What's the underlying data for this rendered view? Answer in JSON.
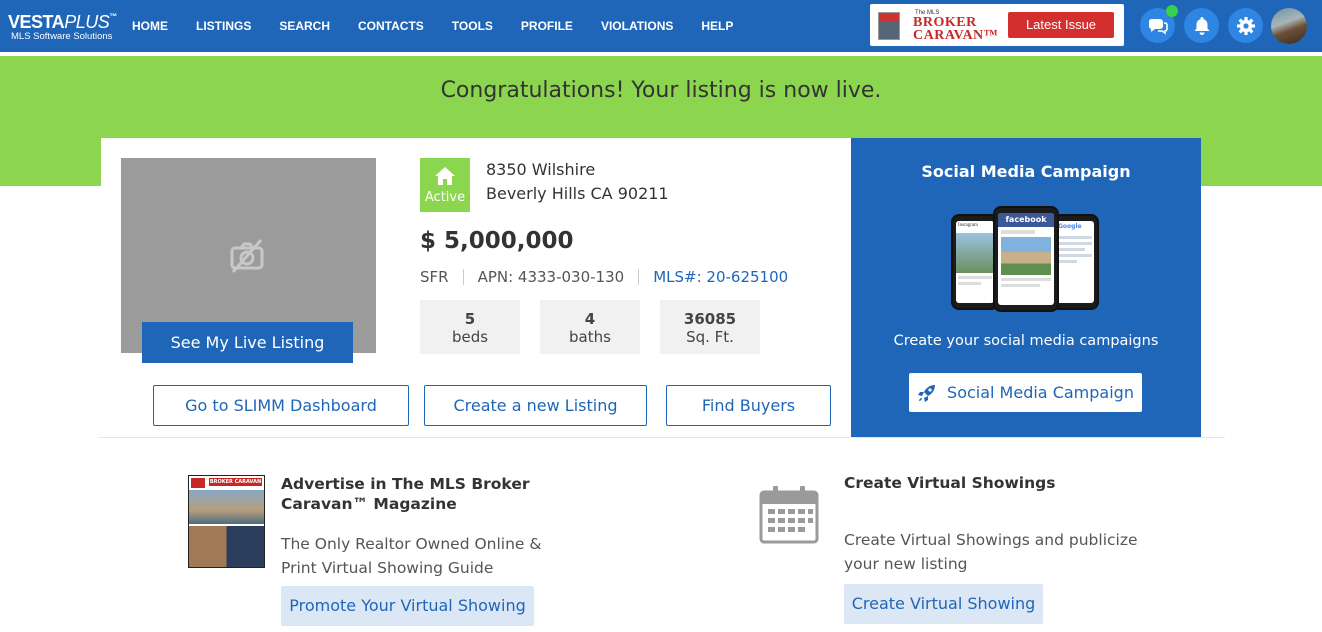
{
  "nav": {
    "logo_main_a": "VESTA",
    "logo_main_b": "PLUS",
    "logo_tm": "™",
    "logo_sub": "MLS Software Solutions",
    "items": [
      "HOME",
      "LISTINGS",
      "SEARCH",
      "CONTACTS",
      "TOOLS",
      "PROFILE",
      "VIOLATIONS",
      "HELP"
    ],
    "caravan": {
      "the_mls": "The MLS",
      "line1": "BROKER",
      "line2": "CARAVAN™",
      "button": "Latest Issue"
    },
    "icons": [
      "chat-icon",
      "bell-icon",
      "gear-icon"
    ]
  },
  "banner": {
    "message": "Congratulations! Your listing is now live."
  },
  "listing": {
    "see_live_button": "See My Live Listing",
    "status": "Active",
    "address_line1": "8350 Wilshire",
    "address_line2": "Beverly Hills CA 90211",
    "price": "$ 5,000,000",
    "type": "SFR",
    "apn": "APN: 4333-030-130",
    "mls": "MLS#: 20-625100",
    "beds": {
      "value": "5",
      "unit": "beds"
    },
    "baths": {
      "value": "4",
      "unit": "baths"
    },
    "sqft": {
      "value": "36085",
      "unit": "Sq. Ft."
    },
    "actions": [
      "Go to SLIMM Dashboard",
      "Create a new Listing",
      "Find Buyers"
    ]
  },
  "social": {
    "title": "Social Media Campaign",
    "phone_labels": [
      "Instagram",
      "facebook",
      "Google"
    ],
    "description": "Create your social media campaigns",
    "button": "Social Media Campaign"
  },
  "advertise": {
    "title": "Advertise in The MLS Broker Caravan™ Magazine",
    "description": "The Only Realtor Owned Online & Print Virtual Showing Guide",
    "button": "Promote Your Virtual Showing",
    "mag_title": "BROKER CARAVAN"
  },
  "virtual": {
    "title": "Create Virtual Showings",
    "description": "Create Virtual Showings and publicize your new listing",
    "button": "Create Virtual Showing"
  },
  "colors": {
    "primary": "#1f66b8",
    "green": "#8cd64f",
    "red": "#d32f2f"
  }
}
